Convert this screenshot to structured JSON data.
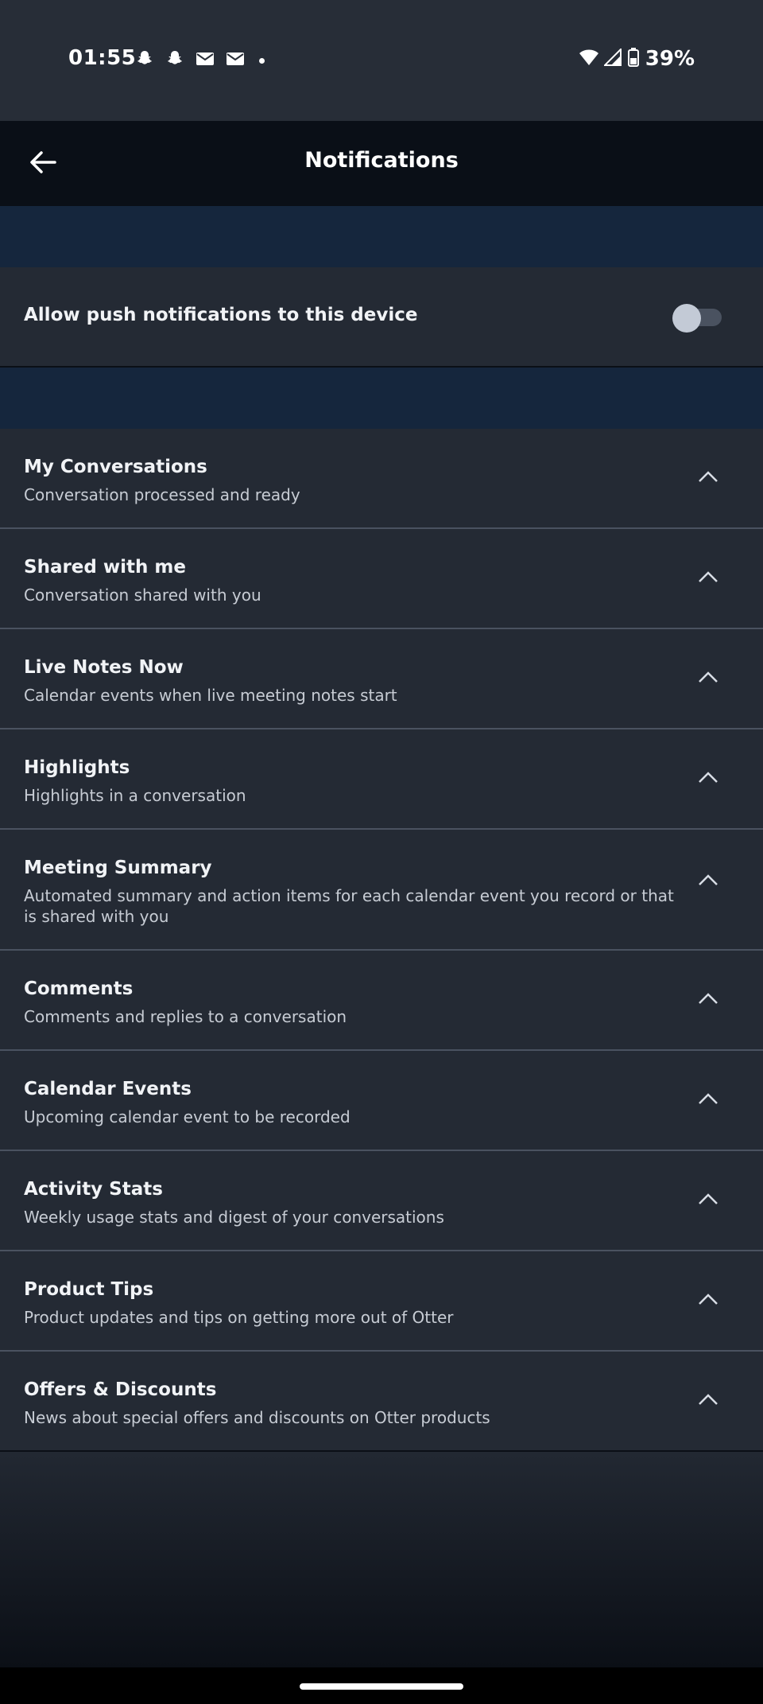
{
  "status_bar": {
    "time": "01:55",
    "battery_percent": "39%",
    "icons": [
      "snapchat-icon",
      "snapchat-icon",
      "mail-icon",
      "mail-icon",
      "dot-icon",
      "wifi-icon",
      "signal-icon",
      "battery-icon"
    ]
  },
  "app_bar": {
    "title": "Notifications",
    "back_icon": "arrow-left-icon"
  },
  "push": {
    "label": "Allow push notifications to this device",
    "enabled": false
  },
  "notifications": [
    {
      "title": "My Conversations",
      "subtitle": "Conversation processed and ready"
    },
    {
      "title": "Shared with me",
      "subtitle": "Conversation shared with you"
    },
    {
      "title": "Live Notes Now",
      "subtitle": "Calendar events when live meeting notes start"
    },
    {
      "title": "Highlights",
      "subtitle": "Highlights in a conversation"
    },
    {
      "title": "Meeting Summary",
      "subtitle": "Automated summary and action items for each calendar event you record or that is shared with you"
    },
    {
      "title": "Comments",
      "subtitle": "Comments and replies to a conversation"
    },
    {
      "title": "Calendar Events",
      "subtitle": "Upcoming calendar event to be recorded"
    },
    {
      "title": "Activity Stats",
      "subtitle": "Weekly usage stats and digest of your conversations"
    },
    {
      "title": "Product Tips",
      "subtitle": "Product updates and tips on getting more out of Otter"
    },
    {
      "title": "Offers & Discounts",
      "subtitle": "News about special offers and discounts on Otter products"
    }
  ],
  "colors": {
    "background": "#222832",
    "app_bar": "#0a0f17",
    "section_band": "#15263d",
    "divider": "#4a5260",
    "text_primary": "#f1f3f6",
    "text_secondary": "#c7ccd4"
  }
}
